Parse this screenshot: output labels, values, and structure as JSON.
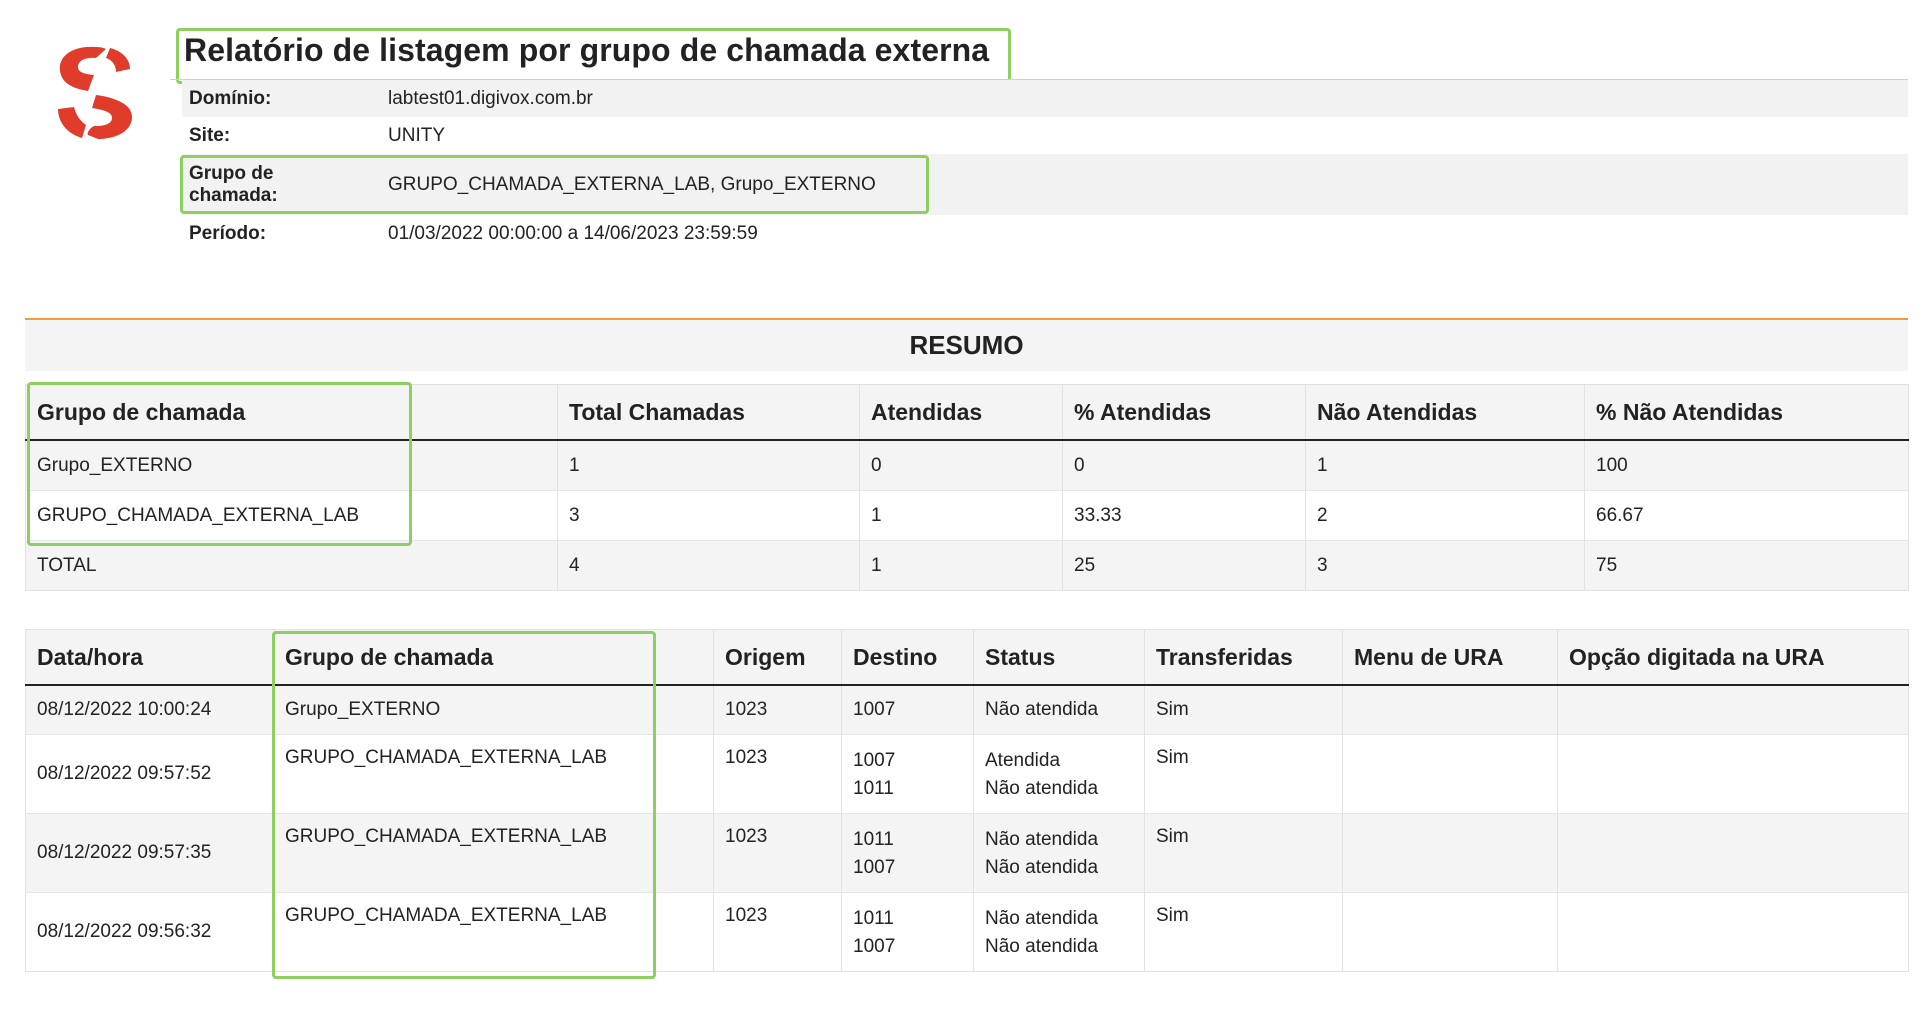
{
  "header": {
    "title": "Relatório de listagem por grupo de chamada externa",
    "meta": [
      {
        "label": "Domínio:",
        "value": "labtest01.digivox.com.br"
      },
      {
        "label": "Site:",
        "value": "UNITY"
      },
      {
        "label": "Grupo de chamada:",
        "value": "GRUPO_CHAMADA_EXTERNA_LAB, Grupo_EXTERNO"
      },
      {
        "label": "Período:",
        "value": "01/03/2022 00:00:00 a 14/06/2023 23:59:59"
      }
    ]
  },
  "summary": {
    "heading": "RESUMO",
    "columns": [
      "Grupo de chamada",
      "Total Chamadas",
      "Atendidas",
      "% Atendidas",
      "Não Atendidas",
      "% Não Atendidas"
    ],
    "rows": [
      [
        "Grupo_EXTERNO",
        "1",
        "0",
        "0",
        "1",
        "100"
      ],
      [
        "GRUPO_CHAMADA_EXTERNA_LAB",
        "3",
        "1",
        "33.33",
        "2",
        "66.67"
      ],
      [
        "TOTAL",
        "4",
        "1",
        "25",
        "3",
        "75"
      ]
    ]
  },
  "detail": {
    "columns": [
      "Data/hora",
      "Grupo de chamada",
      "Origem",
      "Destino",
      "Status",
      "Transferidas",
      "Menu de URA",
      "Opção digitada na URA"
    ],
    "rows": [
      {
        "datetime": "08/12/2022 10:00:24",
        "group": "Grupo_EXTERNO",
        "origin": "1023",
        "destinations": [
          "1007"
        ],
        "statuses": [
          "Não atendida"
        ],
        "transferred": "Sim",
        "ura_menu": "",
        "ura_option": ""
      },
      {
        "datetime": "08/12/2022 09:57:52",
        "group": "GRUPO_CHAMADA_EXTERNA_LAB",
        "origin": "1023",
        "destinations": [
          "1007",
          "1011"
        ],
        "statuses": [
          "Atendida",
          "Não atendida"
        ],
        "transferred": "Sim",
        "ura_menu": "",
        "ura_option": ""
      },
      {
        "datetime": "08/12/2022 09:57:35",
        "group": "GRUPO_CHAMADA_EXTERNA_LAB",
        "origin": "1023",
        "destinations": [
          "1011",
          "1007"
        ],
        "statuses": [
          "Não atendida",
          "Não atendida"
        ],
        "transferred": "Sim",
        "ura_menu": "",
        "ura_option": ""
      },
      {
        "datetime": "08/12/2022 09:56:32",
        "group": "GRUPO_CHAMADA_EXTERNA_LAB",
        "origin": "1023",
        "destinations": [
          "1011",
          "1007"
        ],
        "statuses": [
          "Não atendida",
          "Não atendida"
        ],
        "transferred": "Sim",
        "ura_menu": "",
        "ura_option": ""
      }
    ]
  },
  "colors": {
    "logo_red": "#e03c2c",
    "highlight_green": "#8fcf62",
    "separator_orange": "#f39a3a"
  }
}
